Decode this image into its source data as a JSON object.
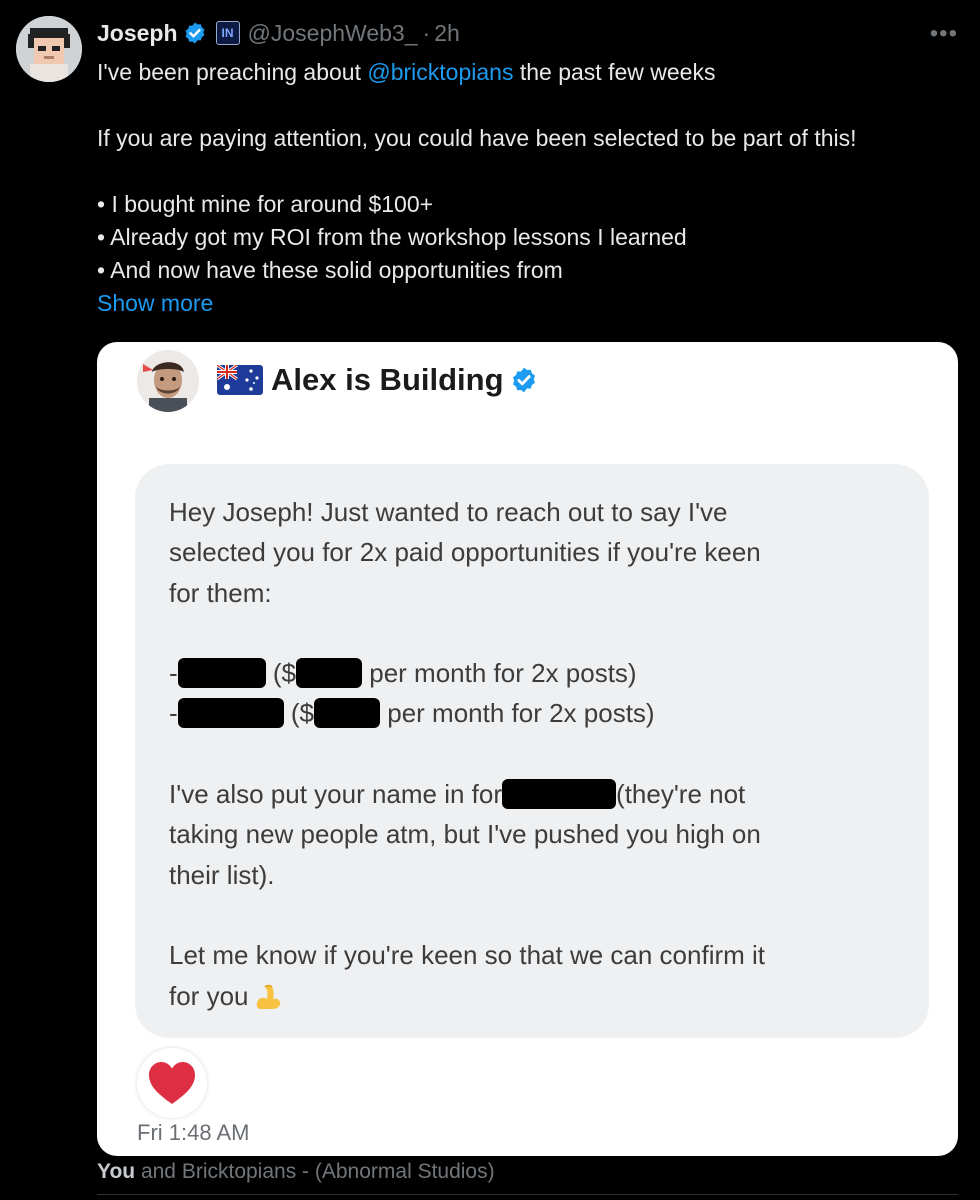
{
  "tweet": {
    "author_name": "Joseph",
    "affiliate_badge": "IN",
    "handle": "@JosephWeb3_",
    "separator": "·",
    "time": "2h",
    "more_menu": "•••",
    "text": {
      "line1_pre": "I've been preaching about ",
      "line1_mention": "@bricktopians",
      "line1_post": " the past few weeks",
      "line2": "If you are paying attention, you could have been selected to be part of this!",
      "bullet1": "• I bought mine for around $100+",
      "bullet2": "• Already got my ROI from the workshop lessons I learned",
      "bullet3": "• And now have these solid opportunities from"
    },
    "show_more": "Show more"
  },
  "card": {
    "sender_name": "Alex is Building",
    "message": {
      "l1": "Hey Joseph! Just wanted to reach out to say I've",
      "l2": "selected you for 2x paid opportunities if you're keen",
      "l3": "for them:",
      "b1_dash": "-",
      "b1_mid": " ($",
      "b1_end": " per month for 2x posts)",
      "b2_dash": "-",
      "b2_mid": " ($",
      "b2_end": " per month for 2x posts)",
      "l4_pre": "I've also put your name in for",
      "l4_post": "(they're not",
      "l5": "taking new people atm, but I've pushed you high on",
      "l6": "their list).",
      "l7": "Let me know if you're keen so that we can confirm it",
      "l8": "for you"
    },
    "message_time": "Fri 1:48 AM"
  },
  "footer": {
    "you": "You",
    "rest": " and Bricktopians - (Abnormal Studios)"
  },
  "colors": {
    "background": "#000000",
    "link": "#1d9bf0",
    "muted": "#71767b",
    "verified": "#1d9bf0",
    "bubble": "#eef0f2",
    "heart": "#dd2e44"
  }
}
